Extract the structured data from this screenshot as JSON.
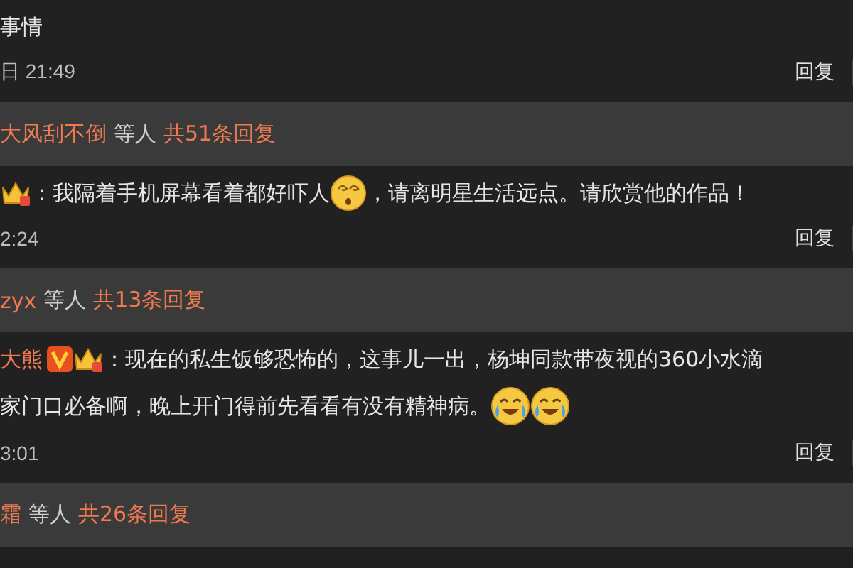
{
  "thread": [
    {
      "kind": "comment",
      "lines": [
        [
          {
            "kind": "text",
            "text": "事情"
          }
        ]
      ],
      "time": "日 21:49",
      "reply": "回复"
    },
    {
      "kind": "summary",
      "names": "大风刮不倒",
      "middle": "等人",
      "count": "共51条回复"
    },
    {
      "kind": "comment",
      "badges": [
        {
          "kind": "crown"
        }
      ],
      "lines": [
        [
          {
            "kind": "text",
            "text": "：我隔着手机屏幕看着都好吓人"
          },
          {
            "kind": "dizzy"
          },
          {
            "kind": "text",
            "text": "，请离明星生活远点。请欣赏他的作品！"
          }
        ]
      ],
      "time": "2:24",
      "reply": "回复"
    },
    {
      "kind": "summary",
      "names": "zyx",
      "middle": "等人",
      "count": "共13条回复"
    },
    {
      "kind": "comment",
      "author": "大熊",
      "badges": [
        {
          "kind": "verified"
        },
        {
          "kind": "crown"
        }
      ],
      "lines": [
        [
          {
            "kind": "text",
            "text": "：现在的私生饭够恐怖的，这事儿一出，杨坤同款带夜视的360小水滴"
          }
        ],
        [
          {
            "kind": "text",
            "text": "家门口必备啊，晚上开门得前先看看有没有精神病。"
          },
          {
            "kind": "laugh-cry"
          },
          {
            "kind": "laugh-cry"
          }
        ]
      ],
      "time": "3:01",
      "reply": "回复"
    },
    {
      "kind": "summary",
      "names": "霜",
      "middle": "等人",
      "count": "共26条回复"
    }
  ]
}
